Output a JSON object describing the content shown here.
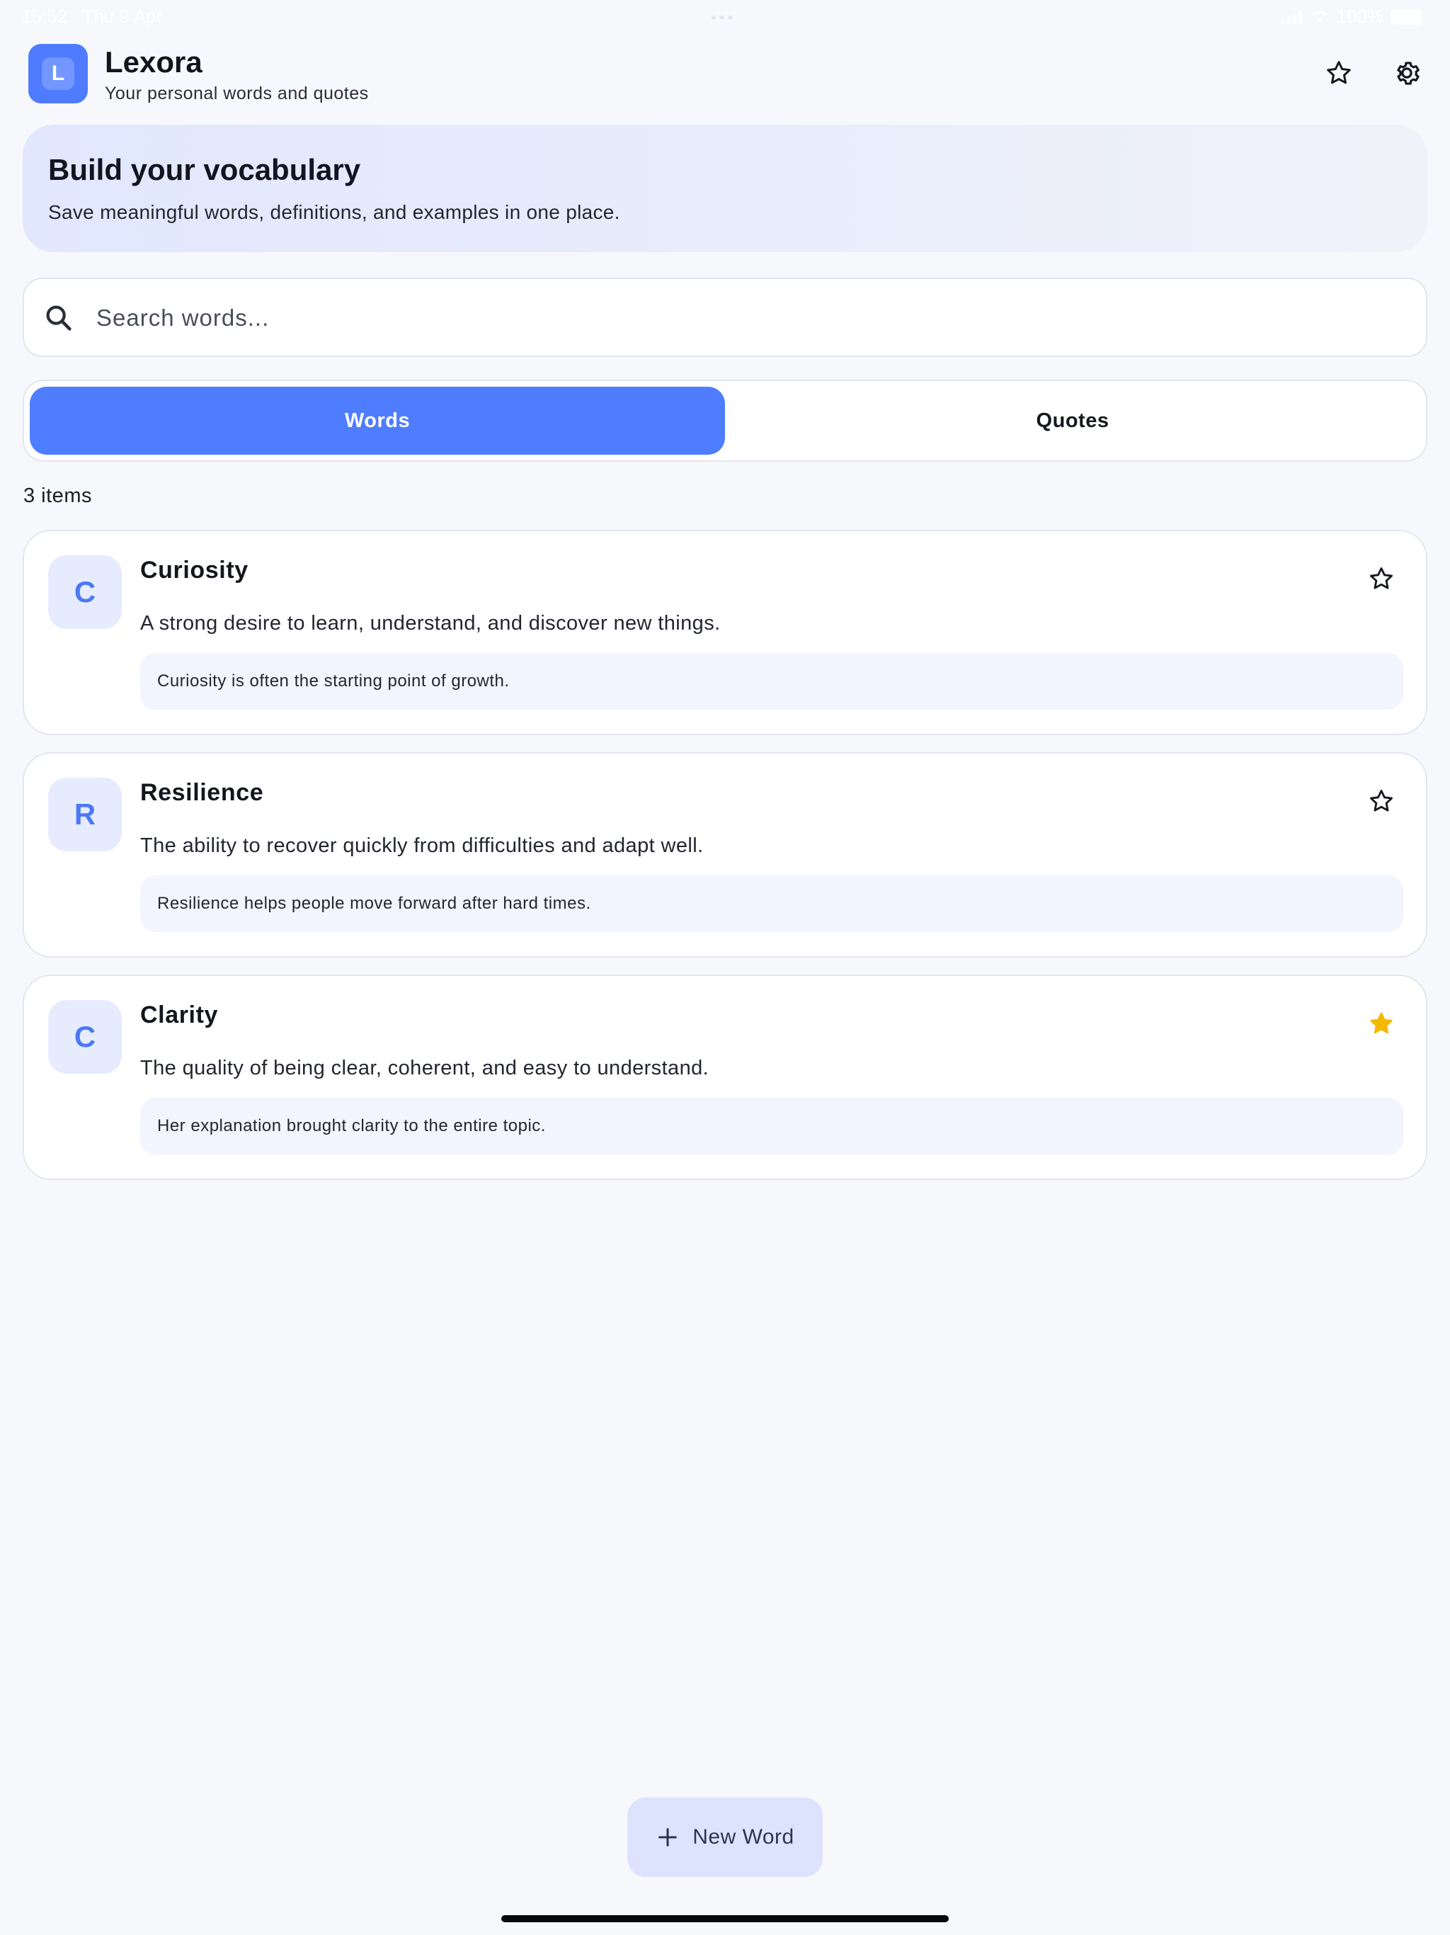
{
  "status_bar": {
    "time": "15:52",
    "date": "Thu 9 Apr",
    "battery": "100%"
  },
  "header": {
    "logo_letter": "L",
    "title": "Lexora",
    "subtitle": "Your personal words and quotes",
    "favorites_icon": "star-outline-icon",
    "settings_icon": "gear-icon"
  },
  "banner": {
    "title": "Build your vocabulary",
    "subtitle": "Save meaningful words, definitions, and examples in one place."
  },
  "search": {
    "placeholder": "Search words...",
    "value": ""
  },
  "tabs": [
    {
      "label": "Words",
      "active": true
    },
    {
      "label": "Quotes",
      "active": false
    }
  ],
  "list": {
    "count_label": "3 items",
    "items": [
      {
        "initial": "C",
        "word": "Curiosity",
        "definition": "A strong desire to learn, understand, and discover new things.",
        "example": "Curiosity is often the starting point of growth.",
        "favorite": false
      },
      {
        "initial": "R",
        "word": "Resilience",
        "definition": "The ability to recover quickly from difficulties and adapt well.",
        "example": "Resilience helps people move forward after hard times.",
        "favorite": false
      },
      {
        "initial": "C",
        "word": "Clarity",
        "definition": "The quality of being clear, coherent, and easy to understand.",
        "example": "Her explanation brought clarity to the entire topic.",
        "favorite": true
      }
    ]
  },
  "fab": {
    "label": "New Word",
    "icon": "plus-icon"
  },
  "colors": {
    "accent": "#4f7dff",
    "favorite": "#f5b800",
    "background": "#f6f8fc"
  }
}
